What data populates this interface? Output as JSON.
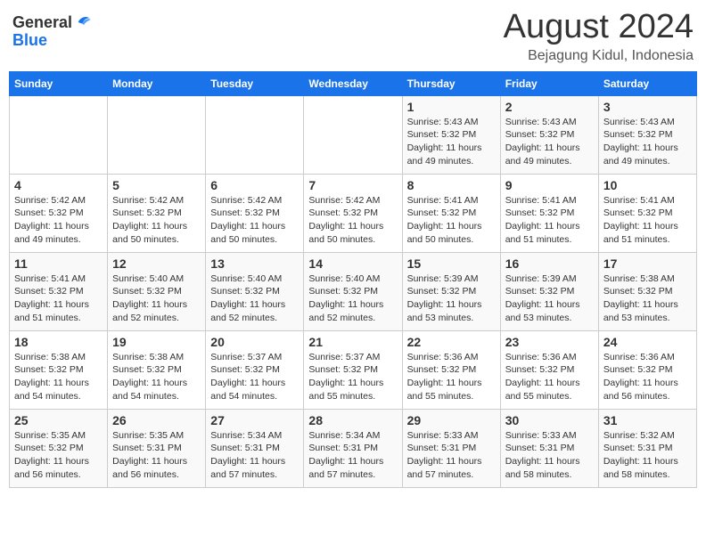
{
  "header": {
    "logo_line1": "General",
    "logo_line2": "Blue",
    "main_title": "August 2024",
    "subtitle": "Bejagung Kidul, Indonesia"
  },
  "weekdays": [
    "Sunday",
    "Monday",
    "Tuesday",
    "Wednesday",
    "Thursday",
    "Friday",
    "Saturday"
  ],
  "weeks": [
    [
      {
        "day": "",
        "info": ""
      },
      {
        "day": "",
        "info": ""
      },
      {
        "day": "",
        "info": ""
      },
      {
        "day": "",
        "info": ""
      },
      {
        "day": "1",
        "info": "Sunrise: 5:43 AM\nSunset: 5:32 PM\nDaylight: 11 hours\nand 49 minutes."
      },
      {
        "day": "2",
        "info": "Sunrise: 5:43 AM\nSunset: 5:32 PM\nDaylight: 11 hours\nand 49 minutes."
      },
      {
        "day": "3",
        "info": "Sunrise: 5:43 AM\nSunset: 5:32 PM\nDaylight: 11 hours\nand 49 minutes."
      }
    ],
    [
      {
        "day": "4",
        "info": "Sunrise: 5:42 AM\nSunset: 5:32 PM\nDaylight: 11 hours\nand 49 minutes."
      },
      {
        "day": "5",
        "info": "Sunrise: 5:42 AM\nSunset: 5:32 PM\nDaylight: 11 hours\nand 50 minutes."
      },
      {
        "day": "6",
        "info": "Sunrise: 5:42 AM\nSunset: 5:32 PM\nDaylight: 11 hours\nand 50 minutes."
      },
      {
        "day": "7",
        "info": "Sunrise: 5:42 AM\nSunset: 5:32 PM\nDaylight: 11 hours\nand 50 minutes."
      },
      {
        "day": "8",
        "info": "Sunrise: 5:41 AM\nSunset: 5:32 PM\nDaylight: 11 hours\nand 50 minutes."
      },
      {
        "day": "9",
        "info": "Sunrise: 5:41 AM\nSunset: 5:32 PM\nDaylight: 11 hours\nand 51 minutes."
      },
      {
        "day": "10",
        "info": "Sunrise: 5:41 AM\nSunset: 5:32 PM\nDaylight: 11 hours\nand 51 minutes."
      }
    ],
    [
      {
        "day": "11",
        "info": "Sunrise: 5:41 AM\nSunset: 5:32 PM\nDaylight: 11 hours\nand 51 minutes."
      },
      {
        "day": "12",
        "info": "Sunrise: 5:40 AM\nSunset: 5:32 PM\nDaylight: 11 hours\nand 52 minutes."
      },
      {
        "day": "13",
        "info": "Sunrise: 5:40 AM\nSunset: 5:32 PM\nDaylight: 11 hours\nand 52 minutes."
      },
      {
        "day": "14",
        "info": "Sunrise: 5:40 AM\nSunset: 5:32 PM\nDaylight: 11 hours\nand 52 minutes."
      },
      {
        "day": "15",
        "info": "Sunrise: 5:39 AM\nSunset: 5:32 PM\nDaylight: 11 hours\nand 53 minutes."
      },
      {
        "day": "16",
        "info": "Sunrise: 5:39 AM\nSunset: 5:32 PM\nDaylight: 11 hours\nand 53 minutes."
      },
      {
        "day": "17",
        "info": "Sunrise: 5:38 AM\nSunset: 5:32 PM\nDaylight: 11 hours\nand 53 minutes."
      }
    ],
    [
      {
        "day": "18",
        "info": "Sunrise: 5:38 AM\nSunset: 5:32 PM\nDaylight: 11 hours\nand 54 minutes."
      },
      {
        "day": "19",
        "info": "Sunrise: 5:38 AM\nSunset: 5:32 PM\nDaylight: 11 hours\nand 54 minutes."
      },
      {
        "day": "20",
        "info": "Sunrise: 5:37 AM\nSunset: 5:32 PM\nDaylight: 11 hours\nand 54 minutes."
      },
      {
        "day": "21",
        "info": "Sunrise: 5:37 AM\nSunset: 5:32 PM\nDaylight: 11 hours\nand 55 minutes."
      },
      {
        "day": "22",
        "info": "Sunrise: 5:36 AM\nSunset: 5:32 PM\nDaylight: 11 hours\nand 55 minutes."
      },
      {
        "day": "23",
        "info": "Sunrise: 5:36 AM\nSunset: 5:32 PM\nDaylight: 11 hours\nand 55 minutes."
      },
      {
        "day": "24",
        "info": "Sunrise: 5:36 AM\nSunset: 5:32 PM\nDaylight: 11 hours\nand 56 minutes."
      }
    ],
    [
      {
        "day": "25",
        "info": "Sunrise: 5:35 AM\nSunset: 5:32 PM\nDaylight: 11 hours\nand 56 minutes."
      },
      {
        "day": "26",
        "info": "Sunrise: 5:35 AM\nSunset: 5:31 PM\nDaylight: 11 hours\nand 56 minutes."
      },
      {
        "day": "27",
        "info": "Sunrise: 5:34 AM\nSunset: 5:31 PM\nDaylight: 11 hours\nand 57 minutes."
      },
      {
        "day": "28",
        "info": "Sunrise: 5:34 AM\nSunset: 5:31 PM\nDaylight: 11 hours\nand 57 minutes."
      },
      {
        "day": "29",
        "info": "Sunrise: 5:33 AM\nSunset: 5:31 PM\nDaylight: 11 hours\nand 57 minutes."
      },
      {
        "day": "30",
        "info": "Sunrise: 5:33 AM\nSunset: 5:31 PM\nDaylight: 11 hours\nand 58 minutes."
      },
      {
        "day": "31",
        "info": "Sunrise: 5:32 AM\nSunset: 5:31 PM\nDaylight: 11 hours\nand 58 minutes."
      }
    ]
  ]
}
